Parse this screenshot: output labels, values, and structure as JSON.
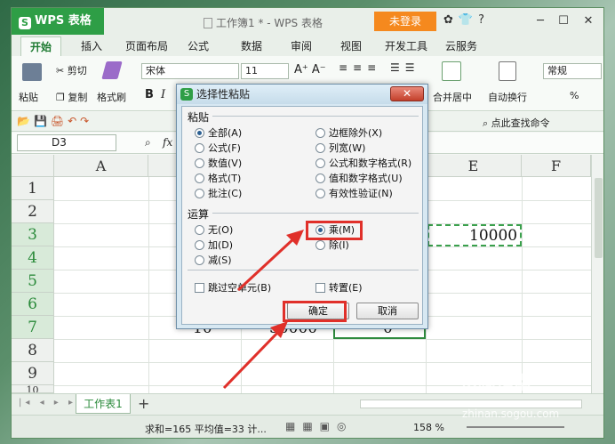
{
  "app": {
    "name": "WPS 表格",
    "doc_title": "工作簿1 * - WPS 表格",
    "login": "未登录"
  },
  "tabs": [
    "开始",
    "插入",
    "页面布局",
    "公式",
    "数据",
    "审阅",
    "视图",
    "开发工具",
    "云服务"
  ],
  "ribbon": {
    "paste": "粘贴",
    "cut": "剪切",
    "copy": "复制",
    "format_painter": "格式刷",
    "font_name": "宋体",
    "font_size": "11",
    "merge_center": "合并居中",
    "wrap_text": "自动换行",
    "number_format": "常规",
    "percent": "%",
    "find_commands": "点此查找命令"
  },
  "formula_bar": {
    "name_box": "D3",
    "fx": "fx"
  },
  "sheet": {
    "columns": [
      "A",
      "E",
      "F"
    ],
    "rows": [
      "1",
      "2",
      "3",
      "4",
      "5",
      "6",
      "7",
      "8",
      "9",
      "10"
    ],
    "cell_e3": "10000",
    "row7_b": "10",
    "row7_c": "50000",
    "row7_d": "0"
  },
  "sheet_tab": "工作表1",
  "status": {
    "text": "求和=165 平均值=33 计...",
    "zoom": "158 %"
  },
  "watermark": {
    "line1": "搜狗指南",
    "line2": "zhinan.sogou.com"
  },
  "dialog": {
    "title": "选择性粘贴",
    "close": "✕",
    "paste_group": "粘贴",
    "paste_options": [
      {
        "label": "全部(A)",
        "checked": true
      },
      {
        "label": "边框除外(X)",
        "checked": false
      },
      {
        "label": "公式(F)",
        "checked": false
      },
      {
        "label": "列宽(W)",
        "checked": false
      },
      {
        "label": "数值(V)",
        "checked": false
      },
      {
        "label": "公式和数字格式(R)",
        "checked": false
      },
      {
        "label": "格式(T)",
        "checked": false
      },
      {
        "label": "值和数字格式(U)",
        "checked": false
      },
      {
        "label": "批注(C)",
        "checked": false
      },
      {
        "label": "有效性验证(N)",
        "checked": false
      }
    ],
    "operation_group": "运算",
    "operation_options": [
      {
        "label": "无(O)",
        "checked": false
      },
      {
        "label": "乘(M)",
        "checked": true
      },
      {
        "label": "加(D)",
        "checked": false
      },
      {
        "label": "除(I)",
        "checked": false
      },
      {
        "label": "减(S)",
        "checked": false
      }
    ],
    "skip_blanks": "跳过空单元(B)",
    "transpose": "转置(E)",
    "ok": "确定",
    "cancel": "取消"
  },
  "colors": {
    "accent": "#2e9e46",
    "login": "#f5891e",
    "highlight": "#e0302a"
  }
}
